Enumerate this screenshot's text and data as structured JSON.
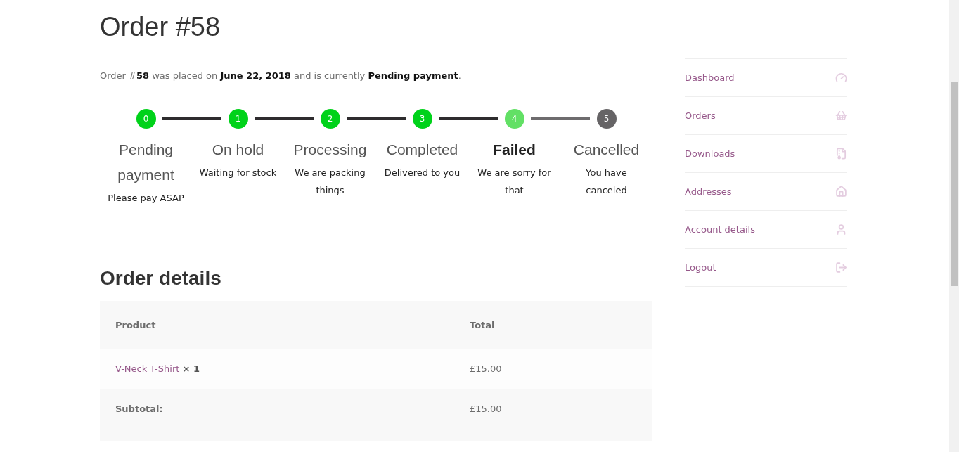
{
  "title": "Order #58",
  "intro": "Order #**58** was placed on **June 22, 2018** and is currently **Pending payment**.",
  "steps": [
    {
      "number": "0",
      "title": "Pending payment",
      "description": "Please pay ASAP",
      "kind": "done"
    },
    {
      "number": "1",
      "title": "On hold",
      "description": "Waiting for stock",
      "kind": "done"
    },
    {
      "number": "2",
      "title": "Processing",
      "description": "We are packing things",
      "kind": "done"
    },
    {
      "number": "3",
      "title": "Completed",
      "description": "Delivered to you",
      "kind": "done"
    },
    {
      "number": "4",
      "title": "Failed",
      "description": "We are sorry for that",
      "kind": "current"
    },
    {
      "number": "5",
      "title": "Cancelled",
      "description": "You have canceled",
      "kind": "pending"
    }
  ],
  "order_details": {
    "heading": "Order details",
    "columns": [
      "Product",
      "Total"
    ],
    "items": [
      {
        "product": "V-Neck T-Shirt",
        "quantity": "× 1",
        "total": "£15.00"
      }
    ],
    "totals": [
      {
        "label": "Subtotal:",
        "value": "£15.00"
      }
    ]
  },
  "sidebar": {
    "items": [
      {
        "label": "Dashboard",
        "kind": "dashboard"
      },
      {
        "label": "Orders",
        "kind": "orders"
      },
      {
        "label": "Downloads",
        "kind": "downloads"
      },
      {
        "label": "Addresses",
        "kind": "addresses"
      },
      {
        "label": "Account details",
        "kind": "account"
      },
      {
        "label": "Logout",
        "kind": "logout"
      }
    ]
  }
}
